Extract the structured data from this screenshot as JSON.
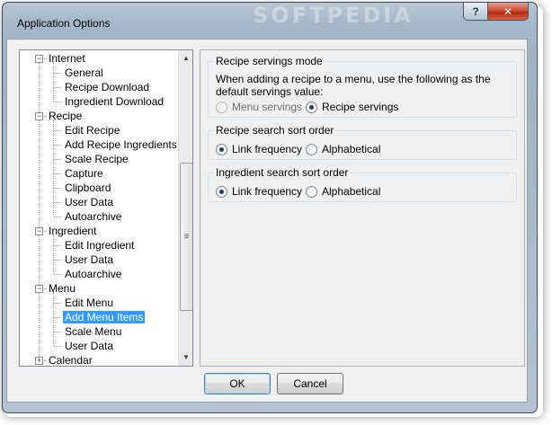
{
  "window": {
    "title": "Application Options",
    "watermark": "SOFTPEDIA",
    "help_label": "?",
    "close_label": "✕"
  },
  "tree": {
    "nodes": [
      {
        "label": "Internet",
        "level": 0,
        "expander": "−"
      },
      {
        "label": "General",
        "level": 1
      },
      {
        "label": "Recipe Download",
        "level": 1
      },
      {
        "label": "Ingredient Download",
        "level": 1
      },
      {
        "label": "Recipe",
        "level": 0,
        "expander": "−"
      },
      {
        "label": "Edit Recipe",
        "level": 1
      },
      {
        "label": "Add Recipe Ingredients",
        "level": 1
      },
      {
        "label": "Scale Recipe",
        "level": 1
      },
      {
        "label": "Capture",
        "level": 1
      },
      {
        "label": "Clipboard",
        "level": 1
      },
      {
        "label": "User Data",
        "level": 1
      },
      {
        "label": "Autoarchive",
        "level": 1
      },
      {
        "label": "Ingredient",
        "level": 0,
        "expander": "−"
      },
      {
        "label": "Edit Ingredient",
        "level": 1
      },
      {
        "label": "User Data",
        "level": 1
      },
      {
        "label": "Autoarchive",
        "level": 1
      },
      {
        "label": "Menu",
        "level": 0,
        "expander": "−"
      },
      {
        "label": "Edit Menu",
        "level": 1
      },
      {
        "label": "Add Menu Items",
        "level": 1,
        "selected": true
      },
      {
        "label": "Scale Menu",
        "level": 1
      },
      {
        "label": "User Data",
        "level": 1
      },
      {
        "label": "Calendar",
        "level": 0,
        "expander": "+"
      }
    ],
    "scroll_up": "▲",
    "scroll_down": "▼",
    "scroll_grip": "≡"
  },
  "options": {
    "servings": {
      "title": "Recipe servings mode",
      "description_line1": "When adding a recipe to a menu, use the following as the",
      "description_line2": "default servings value:",
      "opt1": "Menu servings",
      "opt2": "Recipe servings",
      "selected": "Recipe servings"
    },
    "recipe_sort": {
      "title": "Recipe search sort order",
      "opt1": "Link frequency",
      "opt2": "Alphabetical",
      "selected": "Link frequency"
    },
    "ingredient_sort": {
      "title": "Ingredient search sort order",
      "opt1": "Link frequency",
      "opt2": "Alphabetical",
      "selected": "Link frequency"
    }
  },
  "buttons": {
    "ok": "OK",
    "cancel": "Cancel"
  }
}
